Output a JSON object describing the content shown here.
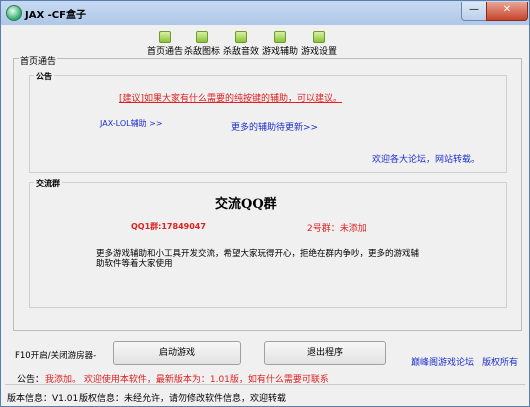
{
  "window": {
    "title": "JAX -CF盒子",
    "minimize_glyph": "—",
    "close_glyph": "✕"
  },
  "toolbar": {
    "items": [
      {
        "label": "首页通告",
        "icon": "green-square-icon"
      },
      {
        "label": "杀敌图标",
        "icon": "green-square-icon"
      },
      {
        "label": "杀敌音效",
        "icon": "green-square-icon"
      },
      {
        "label": "游戏辅助",
        "icon": "green-square-icon"
      },
      {
        "label": "游戏设置",
        "icon": "green-square-icon"
      }
    ]
  },
  "main": {
    "tab_title": "首页通告",
    "notice_group": {
      "title": "公告",
      "suggestion_link": "[建议]如果大家有什么需要的纯按键的辅助，可以建议。",
      "lol_link": "JAX-LOL辅助 >>",
      "more_link": "更多的辅助待更新>>",
      "welcome": "欢迎各大论坛，网站转载。"
    },
    "chat_group": {
      "title": "交流群",
      "heading": "交流QQ群",
      "group1": "QQ1群:17849047",
      "group2": "2号群：未添加",
      "description": "更多游戏辅助和小工具开发交流，希望大家玩得开心，拒绝在群内争吵，更多的游戏辅助软件等着大家使用"
    }
  },
  "bottom": {
    "hotkey_label": "F10开启/关闭游房器-",
    "start_button": "启动游戏",
    "exit_button": "退出程序",
    "forum_link": "巅峰阁游戏论坛",
    "copyright_link": "版权所有",
    "announce_prefix": "公告：",
    "announce_text": "我添加。 欢迎使用本软件，最新版本为：1.01版，如有什么需要可联系"
  },
  "statusbar": {
    "version": "版本信息：V1.01",
    "copyright": "版权信息：未经允许，请勿修改软件信息，欢迎转载"
  },
  "colors": {
    "accent_red": "#e02020",
    "link_blue": "#1d2fd0",
    "titlebar": "#b8d0ee"
  }
}
